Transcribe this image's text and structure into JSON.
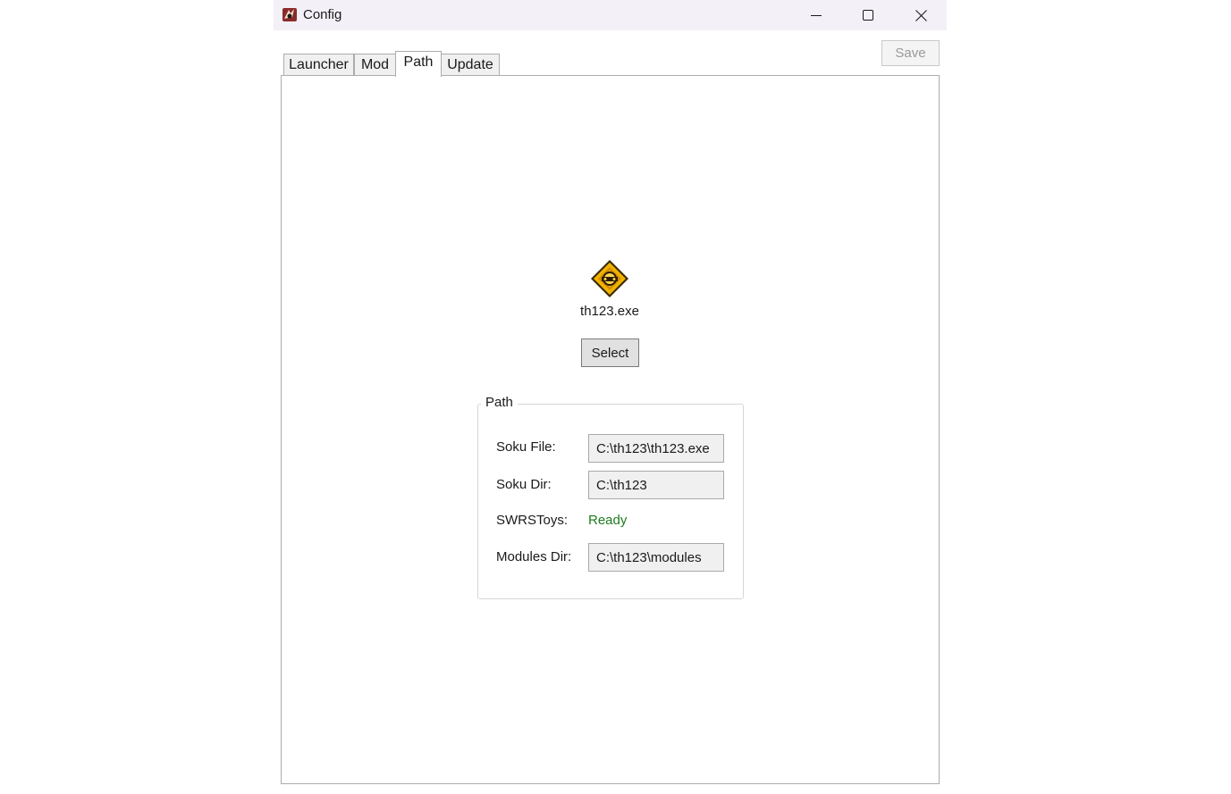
{
  "window": {
    "title": "Config",
    "controls": {
      "minimize": "minimize-icon",
      "maximize": "maximize-icon",
      "close": "close-icon"
    }
  },
  "toolbar": {
    "save_label": "Save"
  },
  "tabs": [
    {
      "label": "Launcher",
      "active": false
    },
    {
      "label": "Mod",
      "active": false
    },
    {
      "label": "Path",
      "active": true
    },
    {
      "label": "Update",
      "active": false
    }
  ],
  "path_tab": {
    "exe_icon": "game-executable-icon",
    "exe_name": "th123.exe",
    "select_label": "Select",
    "group": {
      "title": "Path",
      "rows": [
        {
          "label": "Soku File:",
          "value": "C:\\th123\\th123.exe"
        },
        {
          "label": "Soku Dir:",
          "value": "C:\\th123"
        },
        {
          "label": "SWRSToys:",
          "status": "Ready"
        },
        {
          "label": "Modules Dir:",
          "value": "C:\\th123\\modules"
        }
      ]
    }
  },
  "colors": {
    "titlebar": "#f3f0f7",
    "status_ready": "#1e7b1e",
    "field_background": "#f0f0f0",
    "disabled_text": "#9a9a9a"
  }
}
